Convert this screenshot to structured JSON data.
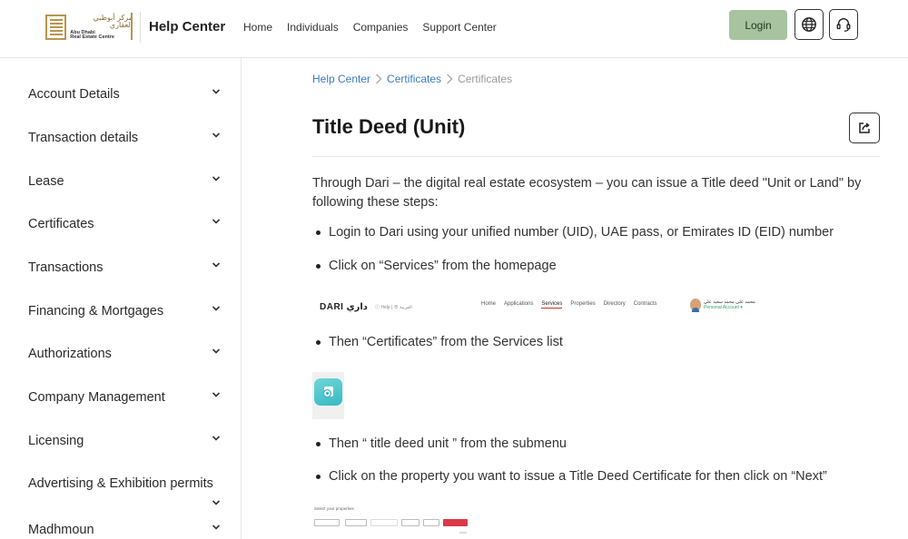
{
  "header": {
    "logo": {
      "arabic": "مركز أبوظبي العقاري",
      "line1": "Abu Dhabi",
      "line2": "Real Estate Centre"
    },
    "title": "Help Center",
    "nav": [
      "Home",
      "Individuals",
      "Companies",
      "Support Center"
    ],
    "login_label": "Login",
    "icons": [
      "globe-icon",
      "headset-icon"
    ],
    "accent_color": "#a8c3a0"
  },
  "sidebar": {
    "items": [
      {
        "label": "Account Details"
      },
      {
        "label": "Transaction details"
      },
      {
        "label": "Lease"
      },
      {
        "label": "Certificates"
      },
      {
        "label": "Transactions"
      },
      {
        "label": "Financing & Mortgages"
      },
      {
        "label": "Authorizations"
      },
      {
        "label": "Company Management"
      },
      {
        "label": "Licensing"
      },
      {
        "label": "Advertising & Exhibition permits"
      },
      {
        "label": "Madhmoun"
      }
    ]
  },
  "breadcrumb": [
    "Help Center",
    "Certificates",
    "Certificates"
  ],
  "page": {
    "title": "Title Deed (Unit)",
    "intro": "Through Dari – the digital real estate ecosystem – you can issue a Title deed \"Unit or Land\"  by following these steps:",
    "steps": [
      "Login to Dari using your unified number (UID), UAE pass, or Emirates ID (EID) number",
      "Click on “Services” from the homepage",
      "Then “Certificates” from the Services list",
      "Then “ title deed unit ” from the submenu",
      "Click on the property you want to issue a Title Deed Certificate for then click on “Next”"
    ]
  },
  "dari_screenshot": {
    "logo": "DARI",
    "logo_ar": "داري",
    "small": "ⓘ Help | ⊕ العربية",
    "nav": [
      "Home",
      "Applications",
      "Services",
      "Properties",
      "Directory",
      "Contracts"
    ],
    "active": "Services",
    "user_name": "محمد علي محمد سعيد علي",
    "user_account": "Personal Account ▾"
  },
  "property_screenshot": {
    "title": "Select your properties"
  }
}
